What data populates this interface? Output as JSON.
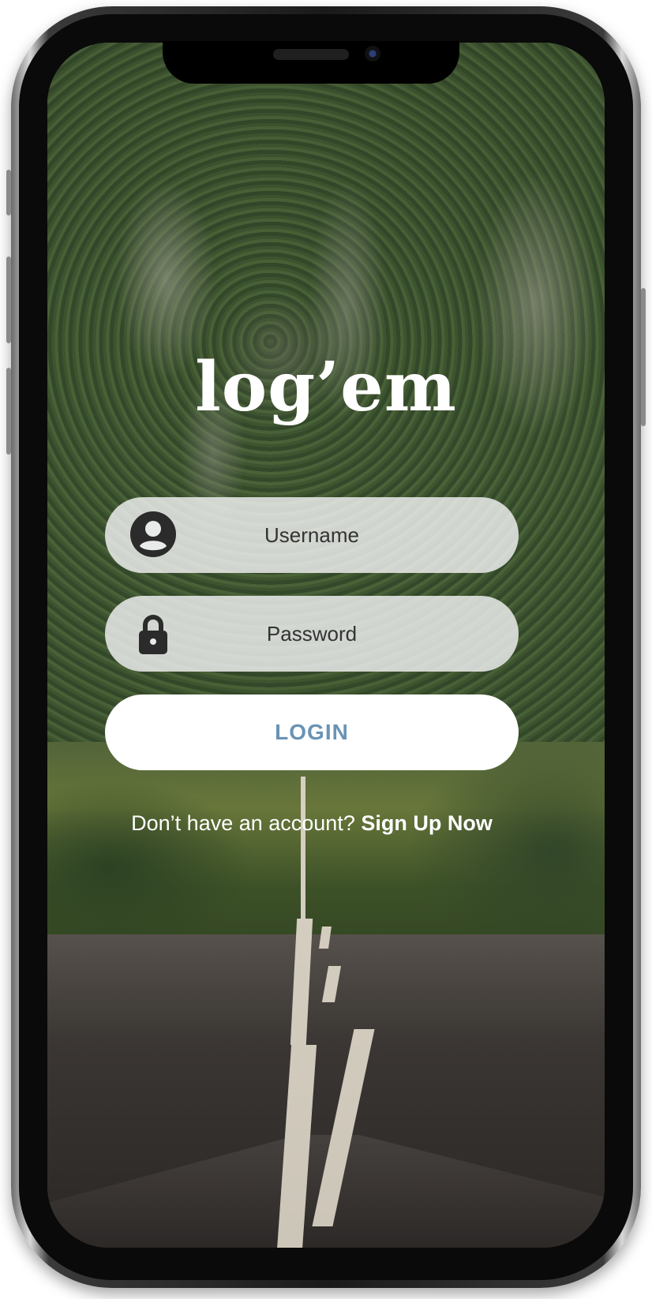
{
  "app": {
    "logo_text": "log’em"
  },
  "login_form": {
    "username_placeholder": "Username",
    "password_placeholder": "Password",
    "login_label": "LOGIN"
  },
  "signup": {
    "prompt": "Don’t have an account?",
    "link_label": "Sign Up Now"
  },
  "icons": {
    "username": "user-circle-icon",
    "password": "lock-icon"
  },
  "colors": {
    "login_text": "#6a93b5",
    "field_bg": "#eef0f0",
    "icon_fill": "#2b2b2b"
  }
}
